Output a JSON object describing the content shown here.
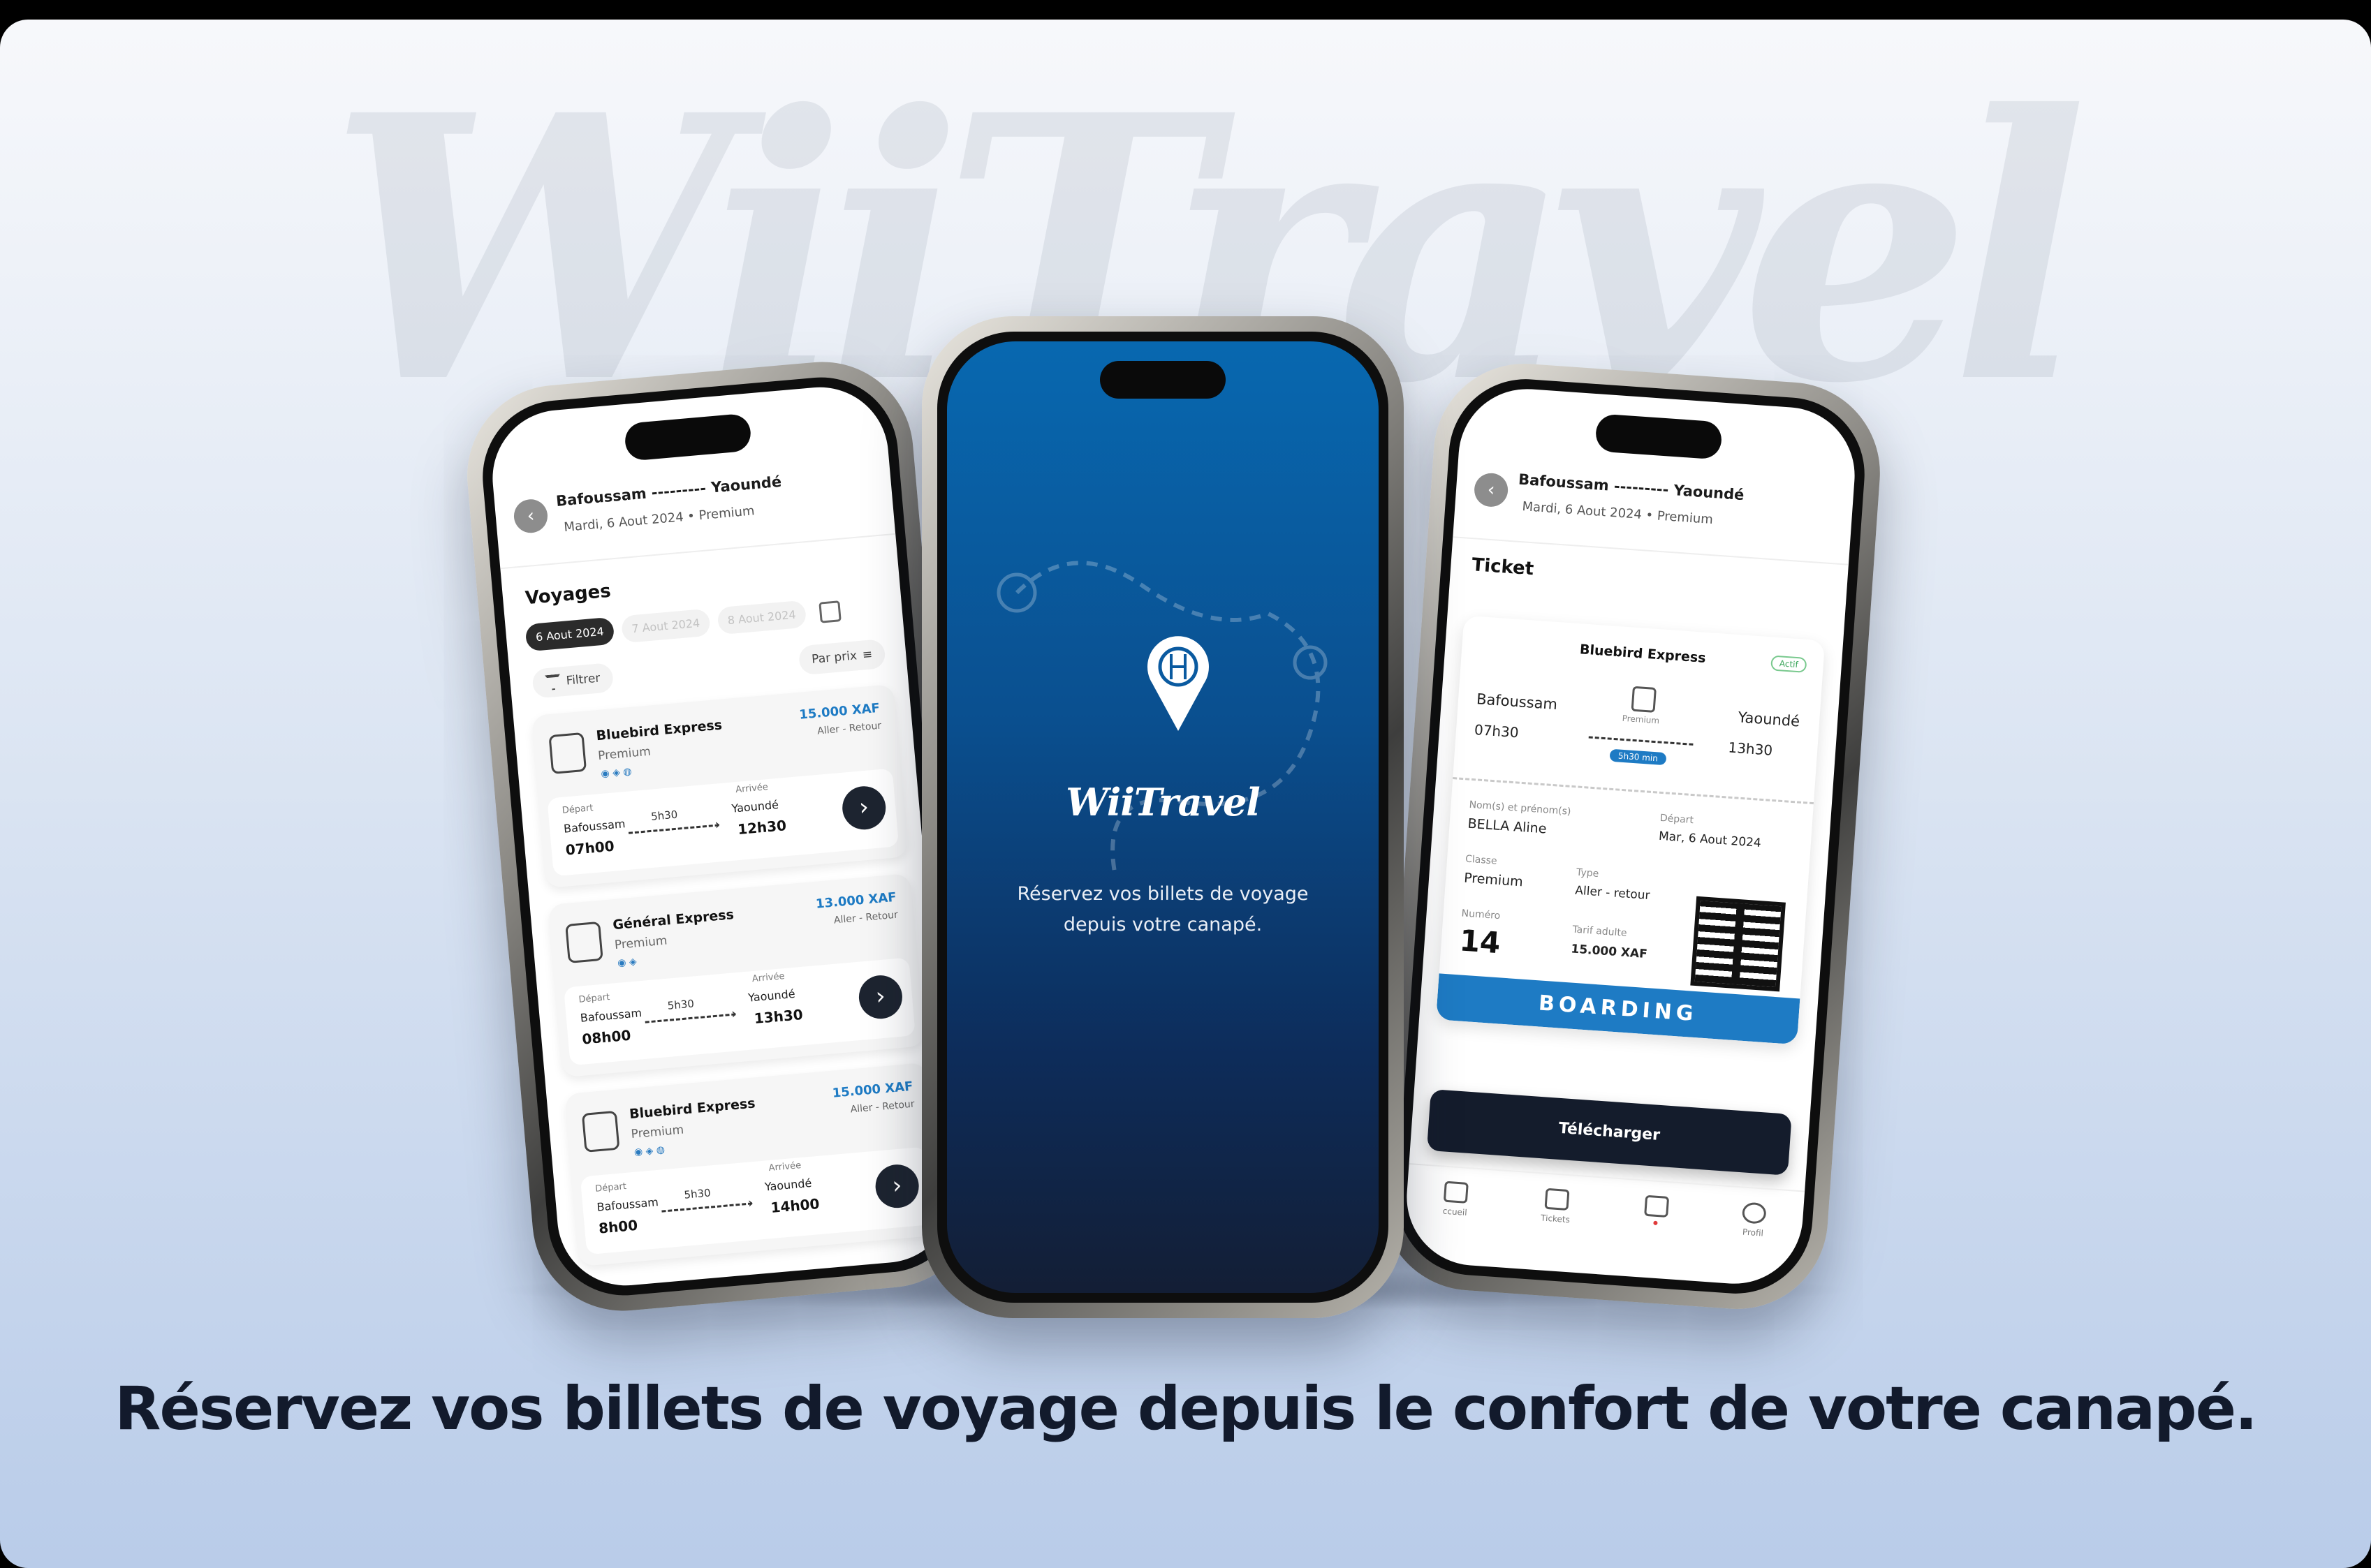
{
  "watermark": "WiiTravel",
  "headline": "Réservez vos billets de voyage depuis le confort de votre canapé.",
  "left_phone": {
    "route_from": "Bafoussam",
    "route_sep": "---------",
    "route_to": "Yaoundé",
    "subtitle": "Mardi, 6 Aout 2024 • Premium",
    "section_title": "Voyages",
    "dates": [
      "6 Aout 2024",
      "7 Aout 2024",
      "8 Aout 2024"
    ],
    "filter_label": "Filtrer",
    "sort_label": "Par prix",
    "trips": [
      {
        "company": "Bluebird Express",
        "tier": "Premium",
        "price": "15.000 XAF",
        "direction": "Aller - Retour",
        "dep_label": "Départ",
        "dep_city": "Bafoussam",
        "dep_time": "07h00",
        "duration": "5h30",
        "arr_label": "Arrivée",
        "arr_city": "Yaoundé",
        "arr_time": "12h30"
      },
      {
        "company": "Général Express",
        "tier": "Premium",
        "price": "13.000 XAF",
        "direction": "Aller - Retour",
        "dep_label": "Départ",
        "dep_city": "Bafoussam",
        "dep_time": "08h00",
        "duration": "5h30",
        "arr_label": "Arrivée",
        "arr_city": "Yaoundé",
        "arr_time": "13h30"
      },
      {
        "company": "Bluebird Express",
        "tier": "Premium",
        "price": "15.000 XAF",
        "direction": "Aller - Retour",
        "dep_label": "Départ",
        "dep_city": "Bafoussam",
        "dep_time": "8h00",
        "duration": "5h30",
        "arr_label": "Arrivée",
        "arr_city": "Yaoundé",
        "arr_time": "14h00"
      }
    ]
  },
  "center_phone": {
    "logo": "WiiTravel",
    "tagline": "Réservez vos billets de voyage depuis votre canapé."
  },
  "right_phone": {
    "route_from": "Bafoussam",
    "route_sep": "---------",
    "route_to": "Yaoundé",
    "subtitle": "Mardi, 6 Aout 2024 • Premium",
    "section_title": "Ticket",
    "ticket": {
      "company": "Bluebird Express",
      "status": "Actif",
      "from_city": "Bafoussam",
      "from_time": "07h30",
      "tier": "Premium",
      "duration": "5h30 min",
      "to_city": "Yaoundé",
      "to_time": "13h30",
      "name_label": "Nom(s) et prénom(s)",
      "name_value": "BELLA Aline",
      "depart_label": "Départ",
      "depart_value": "Mar, 6 Aout 2024",
      "class_label": "Classe",
      "class_value": "Premium",
      "type_label": "Type",
      "type_value": "Aller - retour",
      "number_label": "Numéro",
      "number_value": "14",
      "fare_label": "Tarif adulte",
      "fare_value": "15.000 XAF",
      "boarding": "BOARDING"
    },
    "download_label": "Télécharger",
    "tabs": [
      "ccueil",
      "Tickets",
      "",
      "Profil"
    ]
  },
  "colors": {
    "accent_blue": "#1e7bc4",
    "dark_navy": "#121a2c",
    "splash_top": "#0868b0",
    "splash_bottom": "#131e35"
  }
}
